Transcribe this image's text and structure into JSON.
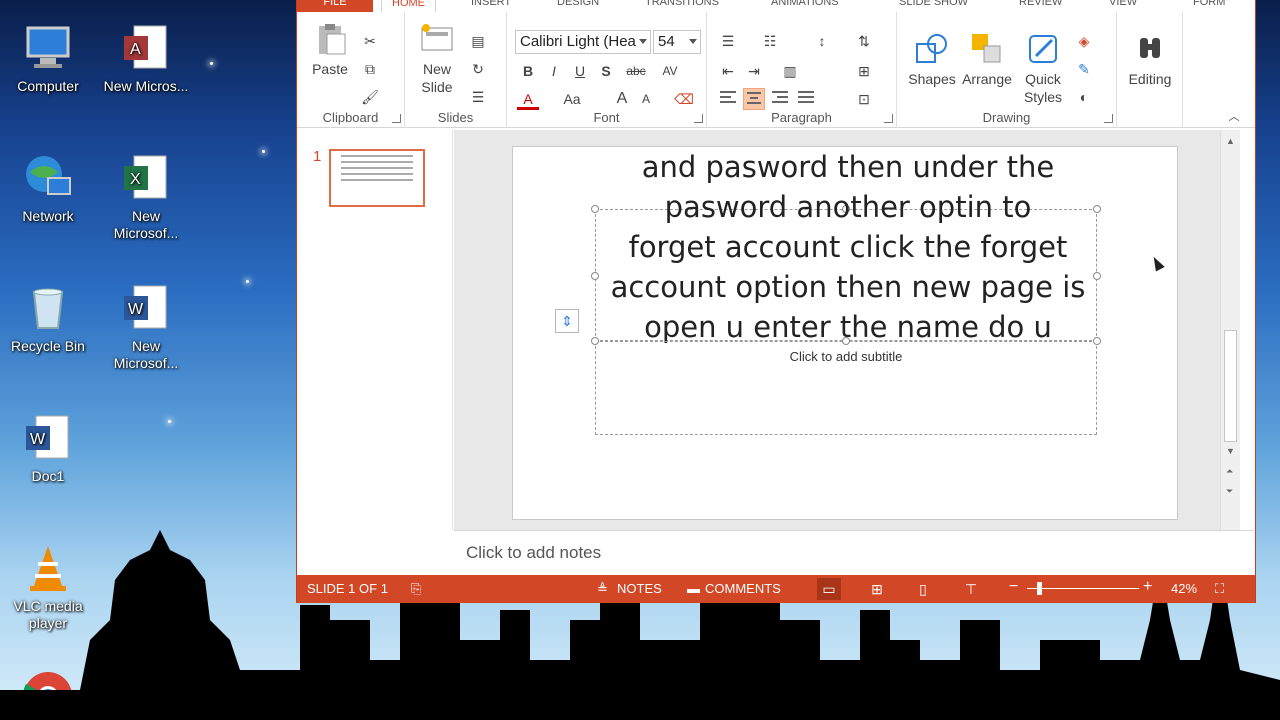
{
  "desktop": {
    "icons": [
      {
        "label": "Computer",
        "icon": "computer-icon"
      },
      {
        "label": "New Micros...",
        "icon": "access-icon"
      },
      {
        "label": "Network",
        "icon": "network-icon"
      },
      {
        "label": "New Microsof...",
        "icon": "excel-icon"
      },
      {
        "label": "Recycle Bin",
        "icon": "recycle-bin-icon"
      },
      {
        "label": "New Microsof...",
        "icon": "word-icon"
      },
      {
        "label": "Doc1",
        "icon": "word-doc-icon"
      },
      {
        "label": "VLC media player",
        "icon": "vlc-icon"
      },
      {
        "label": "",
        "icon": "chrome-icon"
      }
    ]
  },
  "ribbon": {
    "tabs": [
      "FILE",
      "HOME",
      "INSERT",
      "DESIGN",
      "TRANSITIONS",
      "ANIMATIONS",
      "SLIDE SHOW",
      "REVIEW",
      "VIEW",
      "FORM"
    ],
    "active_tab": "HOME",
    "clipboard": {
      "label": "Clipboard",
      "paste": "Paste"
    },
    "slides": {
      "label": "Slides",
      "new_slide": "New Slide"
    },
    "font": {
      "label": "Font",
      "font_name": "Calibri Light (Hea",
      "font_size": "54",
      "bold": "B",
      "italic": "I",
      "underline": "U",
      "shadow": "S",
      "strike": "abc",
      "spacing": "AV",
      "color": "A",
      "case": "Aa",
      "grow": "A",
      "shrink": "A"
    },
    "paragraph": {
      "label": "Paragraph"
    },
    "drawing": {
      "label": "Drawing",
      "shapes": "Shapes",
      "arrange": "Arrange",
      "quick_styles": "Quick Styles"
    },
    "editing": {
      "label": "Editing"
    }
  },
  "thumbnails": {
    "slide_number": "1"
  },
  "slide": {
    "title_lines": [
      "and pasword then under the",
      "pasword another optin to",
      "forget account click the forget",
      "account option then new page is",
      "open u enter the name do u"
    ],
    "subtitle_placeholder": "Click to add subtitle"
  },
  "notes": {
    "placeholder": "Click to add notes"
  },
  "status": {
    "slide_info": "SLIDE 1 OF 1",
    "notes": "NOTES",
    "comments": "COMMENTS",
    "zoom": "42%"
  },
  "colors": {
    "accent": "#d24726"
  }
}
